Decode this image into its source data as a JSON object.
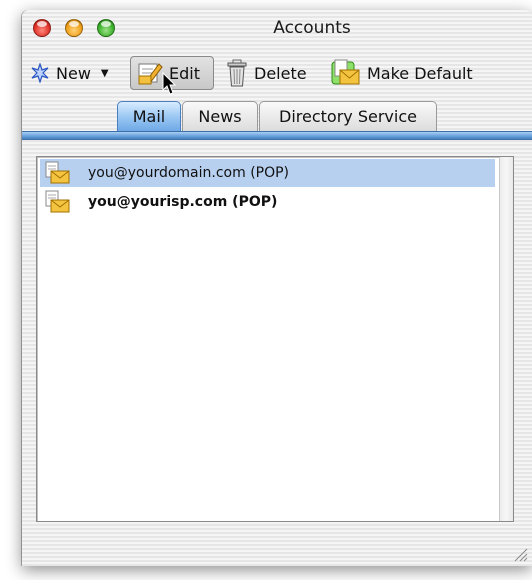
{
  "window": {
    "title": "Accounts"
  },
  "toolbar": {
    "new_label": "New",
    "edit_label": "Edit",
    "delete_label": "Delete",
    "default_label": "Make Default"
  },
  "tabs": [
    {
      "label": "Mail",
      "selected": true
    },
    {
      "label": "News",
      "selected": false
    },
    {
      "label": "Directory Service",
      "selected": false
    }
  ],
  "accounts": [
    {
      "label": "you@yourdomain.com (POP)",
      "selected": true,
      "bold": false
    },
    {
      "label": "you@yourisp.com (POP)",
      "selected": false,
      "bold": true
    }
  ],
  "icons": {
    "new": "star-new-icon",
    "edit": "pencil-edit-icon",
    "delete": "trash-icon",
    "default": "mail-default-icon",
    "account": "mail-account-icon"
  },
  "colors": {
    "selection": "#b8d0f0",
    "tab_accent": "#5d98d6"
  }
}
